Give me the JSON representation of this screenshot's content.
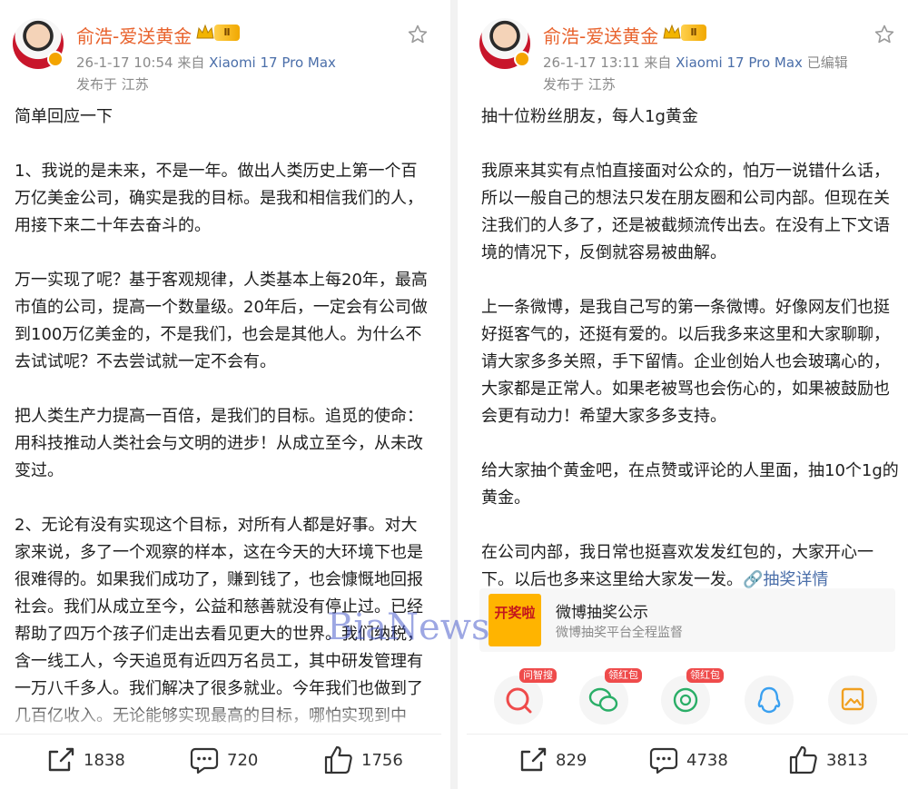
{
  "left": {
    "username": "俞浩-爱送黄金",
    "vip_level": "Ⅱ",
    "time": "26-1-17 10:54",
    "source_prefix": "来自",
    "source_device": "Xiaomi 17 Pro Max",
    "edited": "",
    "location": "发布于 江苏",
    "paragraphs": [
      "简单回应一下",
      "1、我说的是未来，不是一年。做出人类历史上第一个百万亿美金公司，确实是我的目标。是我和相信我们的人，用接下来二十年去奋斗的。",
      "万一实现了呢？基于客观规律，人类基本上每20年，最高市值的公司，提高一个数量级。20年后，一定会有公司做到100万亿美金的，不是我们，也会是其他人。为什么不去试试呢？不去尝试就一定不会有。",
      "把人类生产力提高一百倍，是我们的目标。追觅的使命：用科技推动人类社会与文明的进步！从成立至今，从未改变过。",
      "2、无论有没有实现这个目标，对所有人都是好事。对大家来说，多了一个观察的样本，这在今天的大环境下也是很难得的。如果我们成功了，赚到钱了，也会慷慨地回报社会。我们从成立至今，公益和慈善就没有停止过。已经帮助了四万个孩子们走出去看见更大的世界。我们纳税，含一线工人，今天追觅有近四万名员工，其中研发管理有一万八千多人。我们解决了很多就业。今年我们也做到了几百亿收入。无论能够实现最高的目标，哪怕实现到中途，对大家都是好事啊。"
    ],
    "actions": {
      "share": "1838",
      "comment": "720",
      "like": "1756"
    }
  },
  "right": {
    "username": "俞浩-爱送黄金",
    "vip_level": "Ⅱ",
    "time": "26-1-17 13:11",
    "source_prefix": "来自",
    "source_device": "Xiaomi 17 Pro Max",
    "edited": "已编辑",
    "location": "发布于 江苏",
    "paragraphs": [
      "抽十位粉丝朋友，每人1g黄金",
      "我原来其实有点怕直接面对公众的，怕万一说错什么话，所以一般自己的想法只发在朋友圈和公司内部。但现在关注我们的人多了，还是被截频流传出去。在没有上下文语境的情况下，反倒就容易被曲解。",
      "上一条微博，是我自己写的第一条微博。好像网友们也挺好挺客气的，还挺有爱的。以后我多来这里和大家聊聊，请大家多多关照，手下留情。企业创始人也会玻璃心的，大家都是正常人。如果老被骂也会伤心的，如果被鼓励也会更有动力！希望大家多多支持。",
      "给大家抽个黄金吧，在点赞或评论的人里面，抽10个1g的黄金。"
    ],
    "last_paragraph": "在公司内部，我日常也挺喜欢发发红包的，大家开心一下。以后也多来这里给大家发一发。",
    "lottery_link": "抽奖详情",
    "card": {
      "logo_text": "开奖啦",
      "title": "微博抽奖公示",
      "subtitle": "微博抽奖平台全程监督"
    },
    "share_tags": [
      "问智搜",
      "领红包",
      "领红包"
    ],
    "actions": {
      "share": "829",
      "comment": "4738",
      "like": "3813"
    }
  },
  "watermark": "BiaNews",
  "colors": {
    "username": "#e8622c",
    "link": "#4a6ea9",
    "meta": "#8a8a8a",
    "badge": "#ef4b4b"
  }
}
